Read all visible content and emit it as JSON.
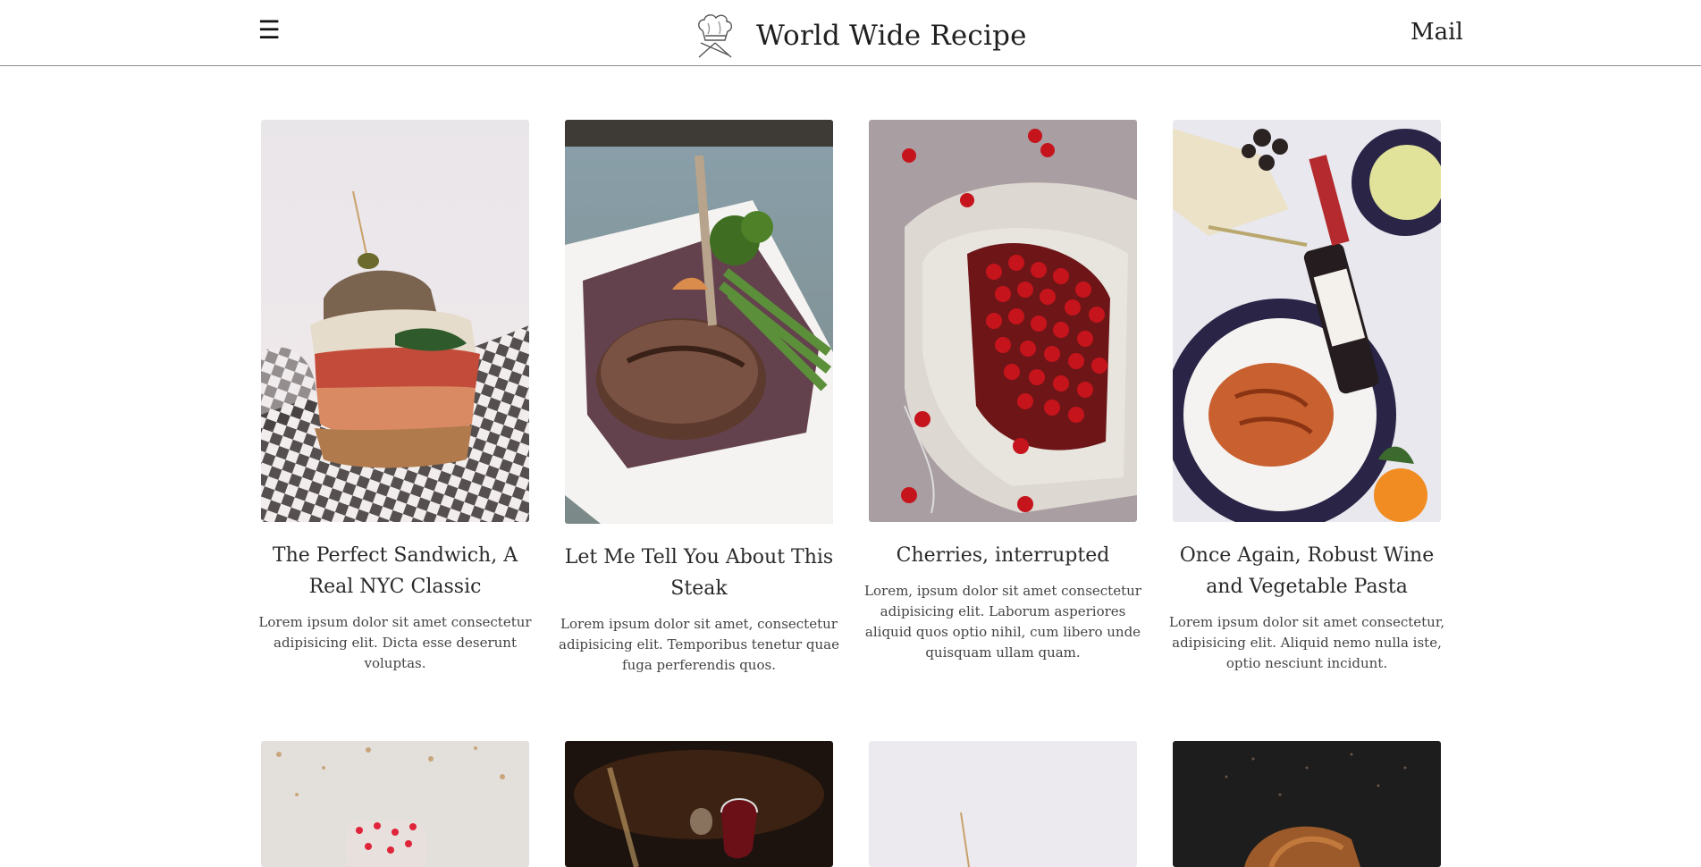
{
  "header": {
    "menu_icon": "☰",
    "site_title": "World Wide Recipe",
    "mail_label": "Mail"
  },
  "cards": [
    {
      "title": "The Perfect Sandwich, A Real NYC Classic",
      "description": "Lorem ipsum dolor sit amet consectetur adipisicing elit. Dicta esse deserunt voluptas.",
      "image": "sandwich-photo"
    },
    {
      "title": "Let Me Tell You About This Steak",
      "description": "Lorem ipsum dolor sit amet, consectetur adipisicing elit. Temporibus tenetur quae fuga perferendis quos.",
      "image": "steak-photo"
    },
    {
      "title": "Cherries, interrupted",
      "description": "Lorem, ipsum dolor sit amet consectetur adipisicing elit. Laborum asperiores aliquid quos optio nihil, cum libero unde quisquam ullam quam.",
      "image": "cherries-photo"
    },
    {
      "title": "Once Again, Robust Wine and Vegetable Pasta",
      "description": "Lorem ipsum dolor sit amet consectetur, adipisicing elit. Aliquid nemo nulla iste, optio nesciunt incidunt.",
      "image": "wine-pasta-photo"
    }
  ],
  "second_row_images": [
    "dessert-photo",
    "wine-glasses-photo",
    "sandwich-photo",
    "bread-photo"
  ],
  "colors": {
    "header_border": "#8c8c8c",
    "text": "#222222"
  }
}
